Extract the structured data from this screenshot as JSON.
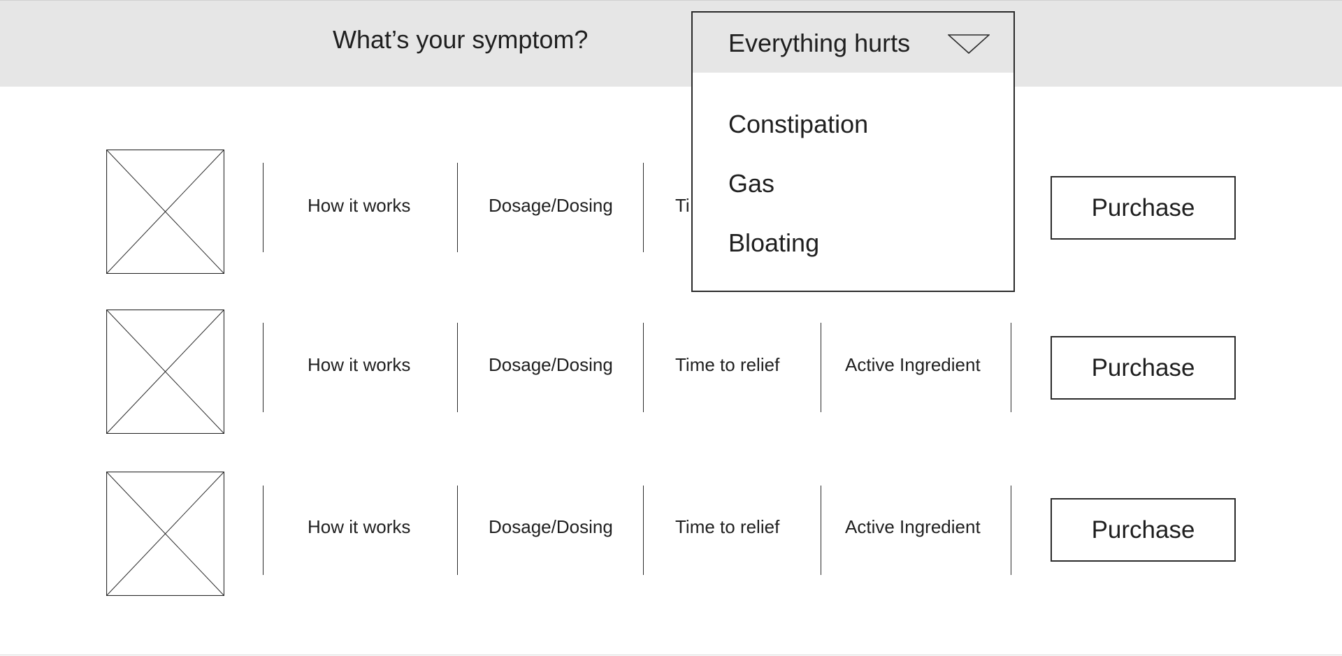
{
  "header": {
    "question": "What’s your symptom?",
    "symptom_select": {
      "selected": "Everything hurts",
      "arrow_icon": "triangle-down-icon",
      "options": [
        "Constipation",
        "Gas",
        "Bloating"
      ]
    }
  },
  "products": [
    {
      "image_icon": "image-placeholder-icon",
      "how_it_works": "How it works",
      "dosage": "Dosage/Dosing",
      "time_to_relief": "Ti",
      "purchase_label": "Purchase"
    },
    {
      "image_icon": "image-placeholder-icon",
      "how_it_works": "How it works",
      "dosage": "Dosage/Dosing",
      "time_to_relief": "Time to relief",
      "active_ingredient": "Active Ingredient",
      "purchase_label": "Purchase"
    },
    {
      "image_icon": "image-placeholder-icon",
      "how_it_works": "How it works",
      "dosage": "Dosage/Dosing",
      "time_to_relief": "Time to relief",
      "active_ingredient": "Active Ingredient",
      "purchase_label": "Purchase"
    }
  ]
}
